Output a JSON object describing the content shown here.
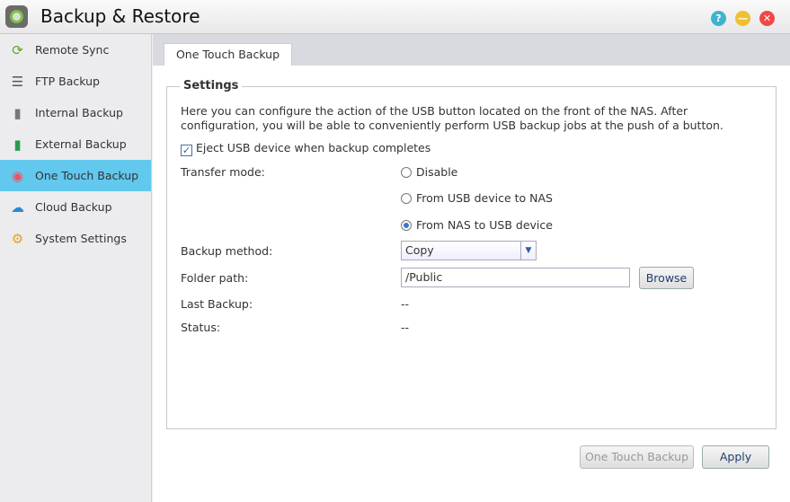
{
  "window": {
    "title": "Backup & Restore",
    "help": "?",
    "minimize": "—",
    "close": "✕"
  },
  "sidebar": {
    "items": [
      {
        "label": "Remote Sync",
        "icon": "remote-sync-icon"
      },
      {
        "label": "FTP Backup",
        "icon": "ftp-icon"
      },
      {
        "label": "Internal Backup",
        "icon": "internal-drive-icon"
      },
      {
        "label": "External Backup",
        "icon": "external-drive-icon"
      },
      {
        "label": "One Touch Backup",
        "icon": "one-touch-icon",
        "active": true
      },
      {
        "label": "Cloud Backup",
        "icon": "cloud-icon"
      },
      {
        "label": "System Settings",
        "icon": "gear-icon"
      }
    ]
  },
  "main": {
    "tab": "One Touch Backup",
    "settings": {
      "legend": "Settings",
      "description": "Here you can configure the action of the USB button located on the front of the NAS. After configuration, you will be able to conveniently perform USB backup jobs at the push of a button.",
      "eject_label": "Eject USB device when backup completes",
      "eject_checked": true,
      "transfer_mode_label": "Transfer mode:",
      "transfer_options": [
        "Disable",
        "From USB device to NAS",
        "From NAS to USB device"
      ],
      "transfer_selected": "From NAS to USB device",
      "backup_method_label": "Backup method:",
      "backup_method": "Copy",
      "folder_path_label": "Folder path:",
      "folder_path": "/Public",
      "browse": "Browse",
      "last_backup_label": "Last Backup:",
      "last_backup": "--",
      "status_label": "Status:",
      "status": "--"
    },
    "one_touch_button": "One Touch Backup",
    "apply": "Apply"
  }
}
